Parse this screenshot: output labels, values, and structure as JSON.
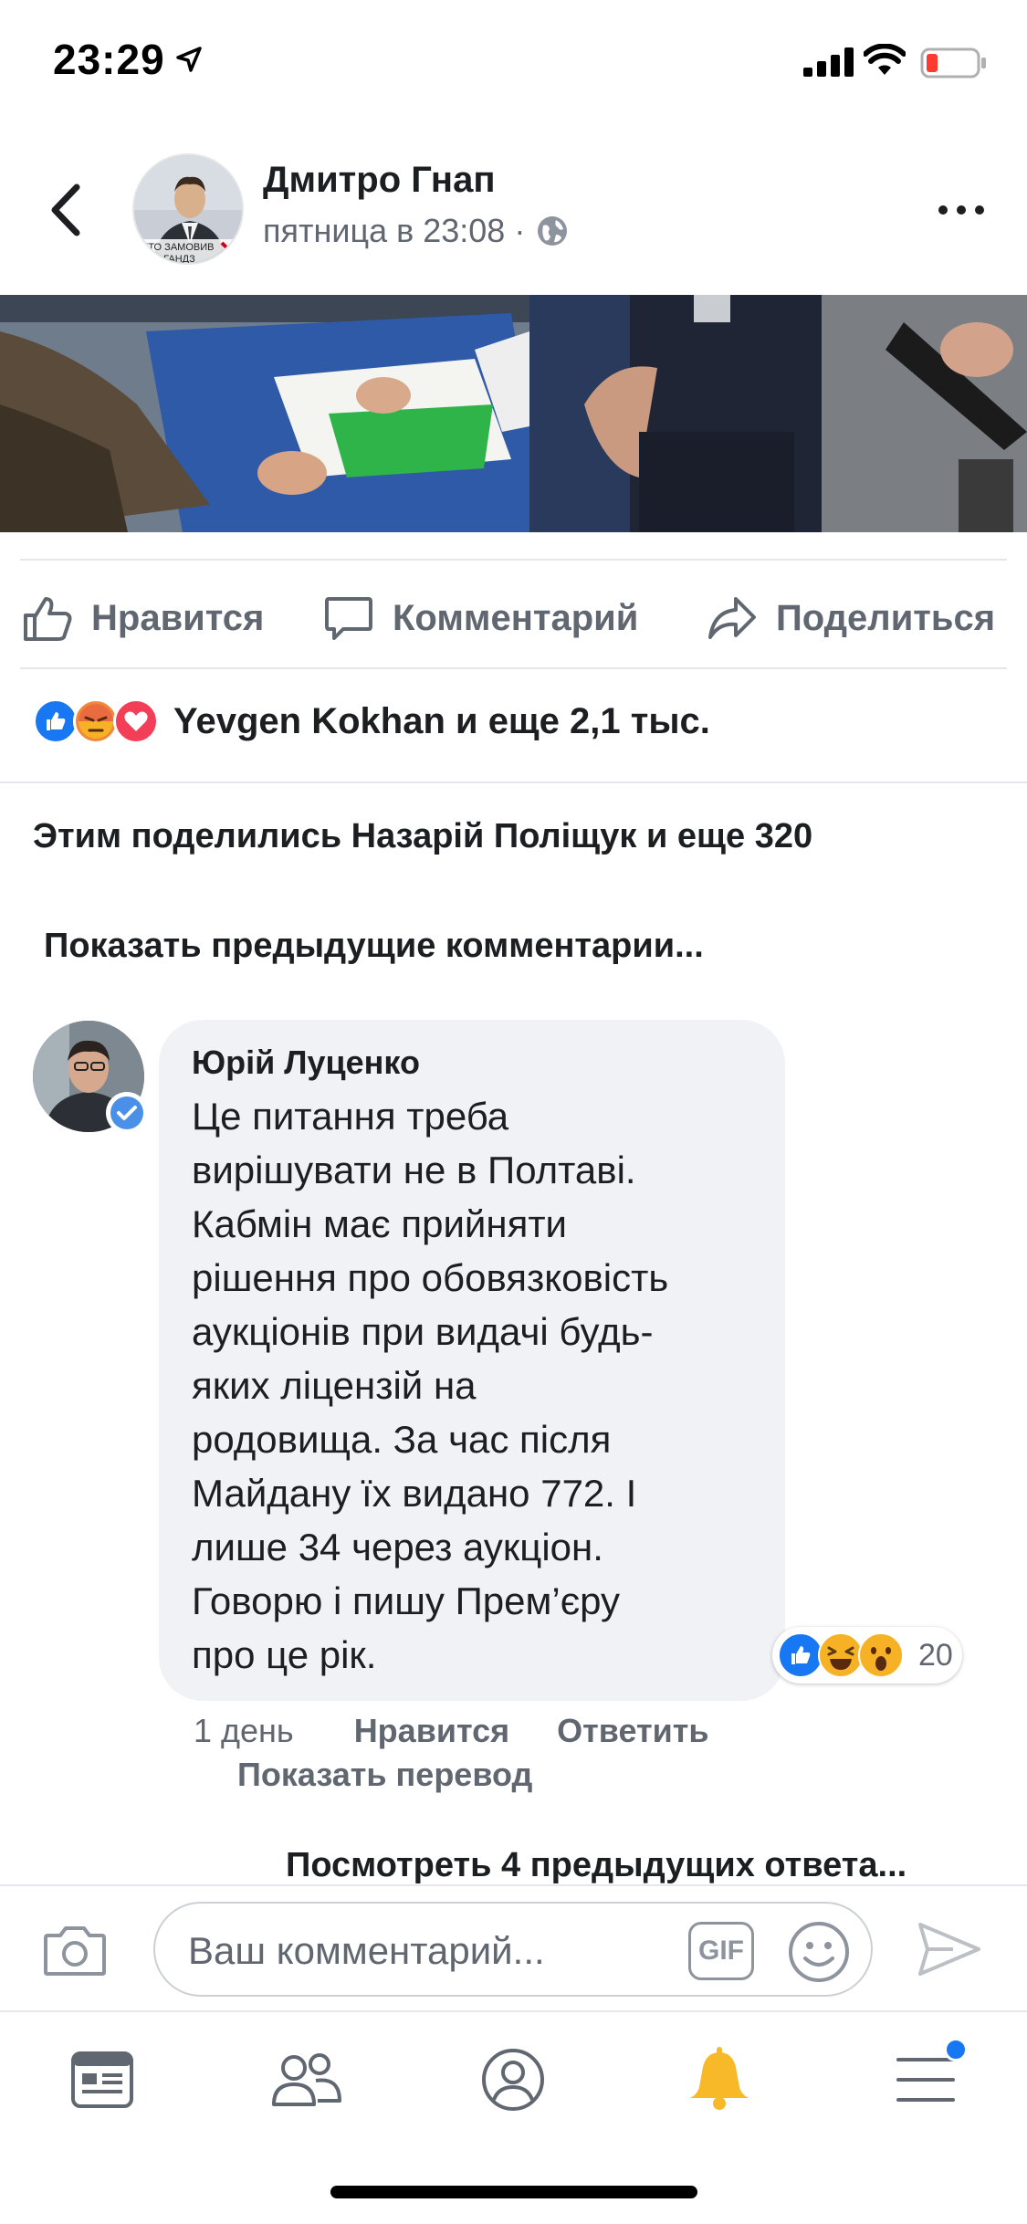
{
  "status_bar": {
    "time": "23:29"
  },
  "post": {
    "author": "Дмитро Гнап",
    "timestamp": "пятница в 23:08 ·",
    "avatar_caption_line1": "ХТО ЗАМОВИВ",
    "avatar_caption_line2": "Ю ГАНДЗ"
  },
  "actions": {
    "like": "Нравится",
    "comment": "Комментарий",
    "share": "Поделиться"
  },
  "reactions_summary": "Yevgen Kokhan и еще 2,1 тыс.",
  "shared_by": "Этим поделились Назарій Поліщук и еще 320",
  "show_previous_comments": "Показать предыдущие комментарии...",
  "comment": {
    "author": "Юрій Луценко",
    "lines": [
      "Це питання треба",
      "вирішувати не в Полтаві.",
      "Кабмін має прийняти",
      "рішення про обовязковість",
      "аукціонів при видачі будь-",
      "яких ліцензій на",
      "родовища. За час після",
      "Майдану їх видано 772. І",
      "лише 34 через аукціон.",
      "Говорю і пишу Прем’єру",
      "про це рік."
    ],
    "reaction_count": "20",
    "time": "1 день",
    "like_label": "Нравится",
    "reply_label": "Ответить",
    "translate_label": "Показать перевод"
  },
  "view_previous_replies": "Посмотреть 4 предыдущих ответа...",
  "composer": {
    "placeholder": "Ваш комментарий...",
    "gif_label": "GIF"
  },
  "colors": {
    "like_blue": "#1877f2",
    "angry_orange": "#f0873a",
    "love_red": "#f33e58",
    "haha_yellow": "#f7b125",
    "text_secondary": "#606770"
  },
  "icons": [
    "back-icon",
    "globe-icon",
    "more-icon",
    "like-icon",
    "comment-icon",
    "share-icon",
    "camera-icon",
    "emoji-icon",
    "send-icon",
    "news-feed-icon",
    "friends-icon",
    "profile-icon",
    "notifications-icon",
    "menu-icon"
  ]
}
